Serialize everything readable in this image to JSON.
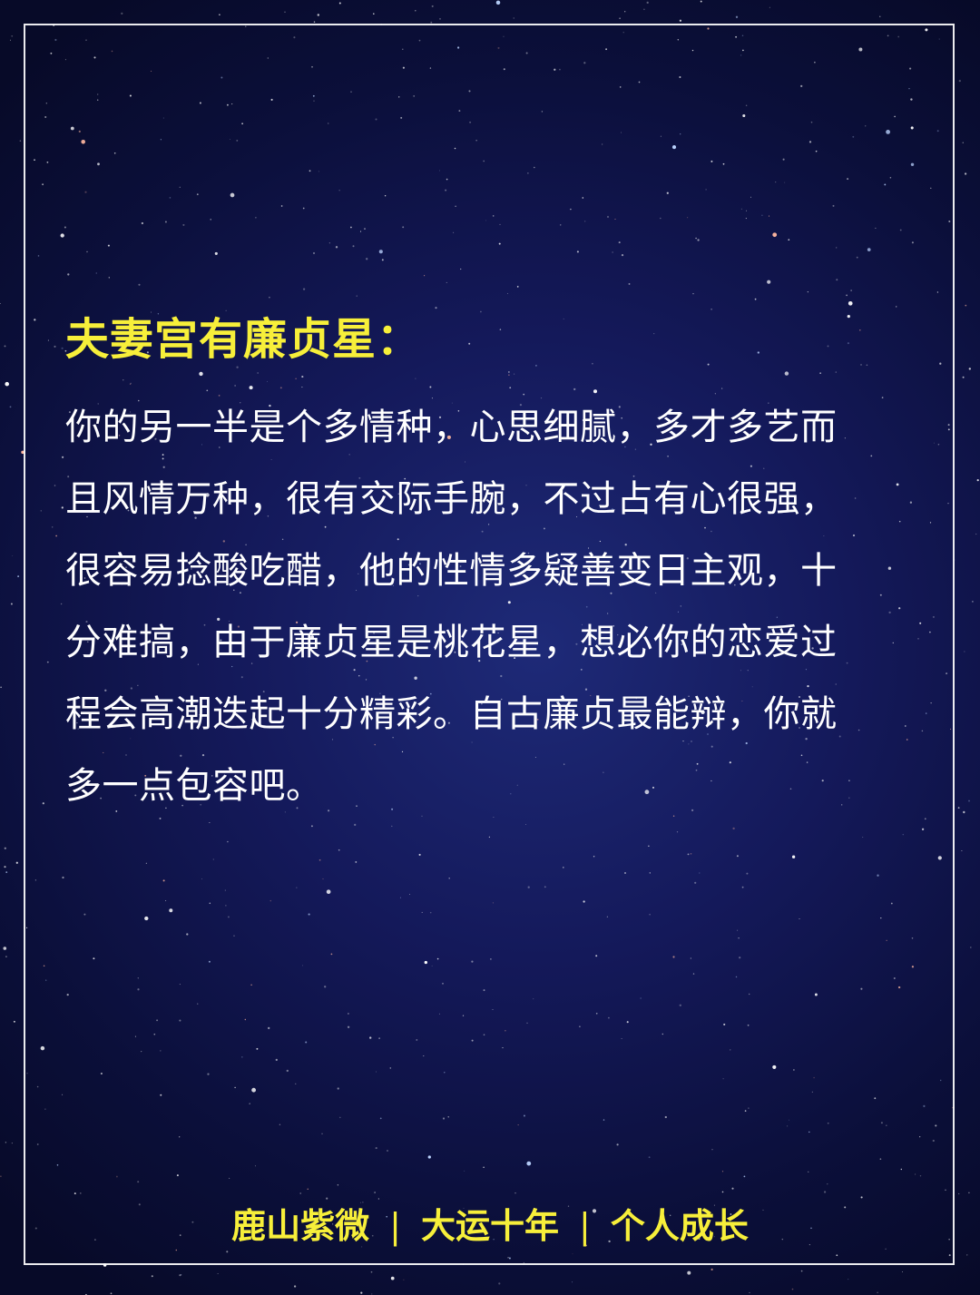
{
  "heading": "夫妻宫有廉贞星：",
  "body_lines": [
    "你的另一半是个多情种，心思细腻，多才多艺而",
    "且风情万种，很有交际手腕，不过占有心很强，",
    "很容易捻酸吃醋，他的性情多疑善变日主观，十",
    "分难搞，由于廉贞星是桃花星，想必你的恋爱过",
    "程会高潮迭起十分精彩。自古廉贞最能辩，你就",
    "多一点包容吧。"
  ],
  "footer": {
    "items": [
      "鹿山紫微",
      "大运十年",
      "个人成长"
    ],
    "separator": "|"
  },
  "colors": {
    "accent_yellow": "#f7ef3a",
    "text_white": "#ffffff",
    "background_navy": "#14195a"
  }
}
